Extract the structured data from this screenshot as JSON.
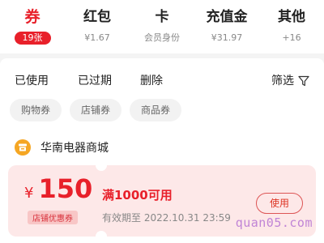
{
  "tabs": [
    {
      "label": "券",
      "sub": "19张",
      "active": true
    },
    {
      "label": "红包",
      "sub": "¥1.67"
    },
    {
      "label": "卡",
      "sub": "会员身份"
    },
    {
      "label": "充值金",
      "sub": "¥31.97"
    },
    {
      "label": "其他",
      "sub": "+16"
    }
  ],
  "filters": {
    "used": "已使用",
    "expired": "已过期",
    "delete": "删除",
    "sift": "筛选"
  },
  "chips": [
    "购物券",
    "店铺券",
    "商品券"
  ],
  "shop": {
    "name": "华南电器商城"
  },
  "coupon": {
    "currency": "¥",
    "amount": "150",
    "type": "店铺优惠券",
    "condition": "满1000可用",
    "validity": "有效期至 2022.10.31 23:59",
    "use_label": "使用"
  },
  "watermark": "quan05.com",
  "colors": {
    "accent": "#e8202a",
    "card_bg": "#fde8e8",
    "shop_icon": "#f5a623"
  }
}
